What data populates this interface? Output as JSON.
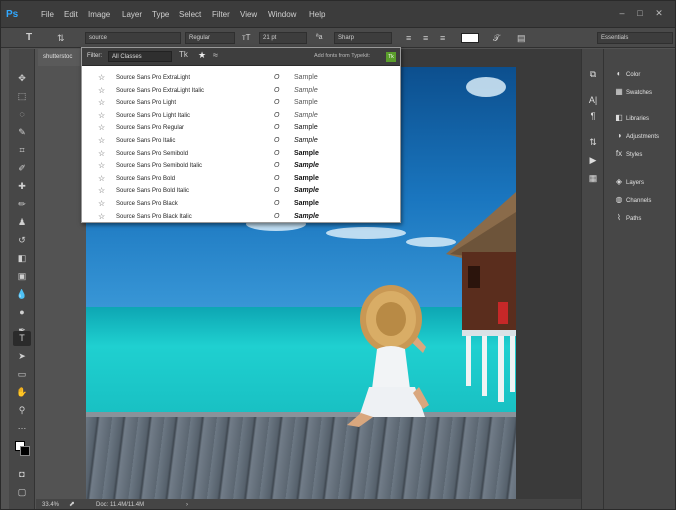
{
  "app": {
    "logo": "Ps"
  },
  "menu": [
    "File",
    "Edit",
    "Image",
    "Layer",
    "Type",
    "Select",
    "Filter",
    "View",
    "Window",
    "Help"
  ],
  "window_controls": [
    "–",
    "□",
    "✕"
  ],
  "options_bar": {
    "tool_icon": "T",
    "font_family": "source",
    "font_style": "Regular",
    "font_size": "21 pt",
    "antialias_icon": "ªa",
    "antialias": "Sharp",
    "workspace": "Essentials"
  },
  "document": {
    "tab_title": "shutterstoc",
    "zoom": "33.4%",
    "doc_info": "Doc: 11.4M/11.4M"
  },
  "font_menu": {
    "filter_label": "Filter:",
    "filter_value": "All Classes",
    "typekit_label": "Add fonts from Typekit:",
    "typekit_icon": "Tk",
    "fonts": [
      {
        "name": "Source Sans Pro ExtraLight",
        "weight": 200,
        "italic": false
      },
      {
        "name": "Source Sans Pro ExtraLight Italic",
        "weight": 200,
        "italic": true
      },
      {
        "name": "Source Sans Pro Light",
        "weight": 300,
        "italic": false
      },
      {
        "name": "Source Sans Pro Light Italic",
        "weight": 300,
        "italic": true
      },
      {
        "name": "Source Sans Pro Regular",
        "weight": 400,
        "italic": false
      },
      {
        "name": "Source Sans Pro Italic",
        "weight": 400,
        "italic": true
      },
      {
        "name": "Source Sans Pro Semibold",
        "weight": 600,
        "italic": false
      },
      {
        "name": "Source Sans Pro Semibold Italic",
        "weight": 600,
        "italic": true
      },
      {
        "name": "Source Sans Pro Bold",
        "weight": 700,
        "italic": false
      },
      {
        "name": "Source Sans Pro Bold Italic",
        "weight": 700,
        "italic": true
      },
      {
        "name": "Source Sans Pro Black",
        "weight": 900,
        "italic": false
      },
      {
        "name": "Source Sans Pro Black Italic",
        "weight": 900,
        "italic": true
      }
    ],
    "sample_text": "Sample",
    "font_type_icon": "O"
  },
  "panels": {
    "group1": [
      "Color",
      "Swatches"
    ],
    "group2": [
      "Libraries",
      "Adjustments",
      "Styles"
    ],
    "group3": [
      "Layers",
      "Channels",
      "Paths"
    ]
  },
  "colors": {
    "accent": "#31a8ff",
    "ui_dark": "#3c3c3c",
    "ui_mid": "#535353"
  }
}
